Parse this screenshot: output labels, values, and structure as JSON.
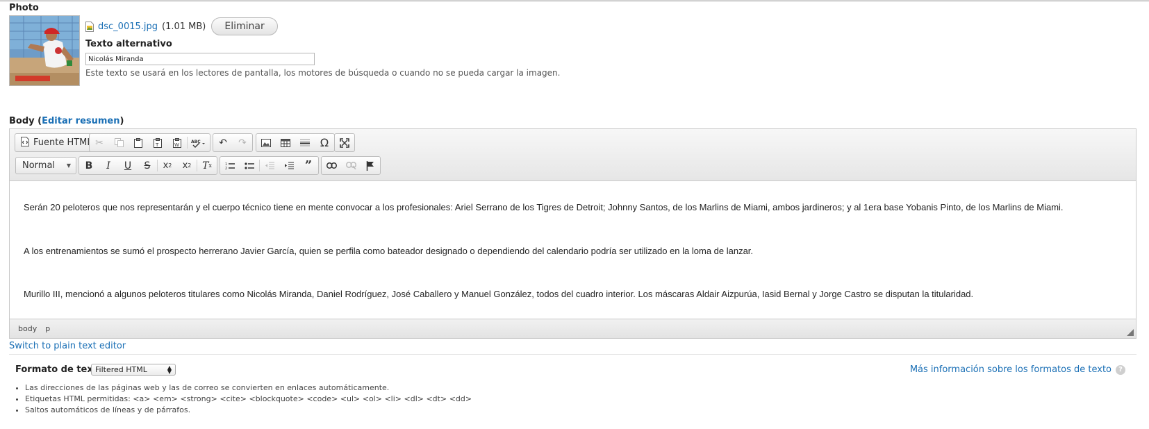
{
  "photo": {
    "label": "Photo",
    "file_name": "dsc_0015.jpg",
    "file_size": "(1.01 MB)",
    "remove_label": "Eliminar",
    "alt_label": "Texto alternativo",
    "alt_value": "Nicolás Miranda",
    "alt_help": "Este texto se usará en los lectores de pantalla, los motores de búsqueda o cuando no se pueda cargar la imagen."
  },
  "body": {
    "label": "Body (",
    "edit_summary": "Editar resumen",
    "label_close": ")"
  },
  "toolbar": {
    "source_label": "Fuente HTML",
    "format_value": "Normal",
    "icons_row1": [
      "cut-icon",
      "copy-icon",
      "paste-icon",
      "paste-text-icon",
      "paste-word-icon",
      "spellcheck-icon",
      "undo-icon",
      "redo-icon",
      "image-icon",
      "table-icon",
      "horizontal-rule-icon",
      "special-char-icon",
      "maximize-icon"
    ],
    "icons_row2": [
      "bold-icon",
      "italic-icon",
      "underline-icon",
      "strike-icon",
      "subscript-icon",
      "superscript-icon",
      "remove-format-icon",
      "numbered-list-icon",
      "bulleted-list-icon",
      "outdent-icon",
      "indent-icon",
      "blockquote-icon",
      "link-icon",
      "unlink-icon",
      "anchor-icon"
    ]
  },
  "content": {
    "paragraphs": [
      "Serán 20 peloteros que nos representarán y el cuerpo técnico tiene en mente convocar a los profesionales: Ariel Serrano de los Tigres de Detroit; Johnny Santos, de los Marlins de Miami, ambos jardineros; y al 1era base Yobanis Pinto, de los Marlins de Miami.",
      "A los entrenamientos se sumó el prospecto herrerano Javier García, quien se perfila como bateador designado o dependiendo del calendario podría ser utilizado en la loma de lanzar.",
      "Murillo III, mencionó a algunos peloteros titulares como Nicolás Miranda, Daniel Rodríguez, José Caballero y Manuel González, todos del cuadro interior. Los máscaras Aldair Aizpurúa, Iasid Bernal y Jorge Castro se disputan la titularidad."
    ]
  },
  "pathbar": {
    "items": [
      "body",
      "p"
    ]
  },
  "switch_editor": "Switch to plain text editor",
  "text_format": {
    "label": "Formato de texto",
    "selected": "Filtered HTML",
    "more_info": "Más información sobre los formatos de texto",
    "tips": [
      "Las direcciones de las páginas web y las de correo se convierten en enlaces automáticamente.",
      "Etiquetas HTML permitidas: <a> <em> <strong> <cite> <blockquote> <code> <ul> <ol> <li> <dl> <dt> <dd>",
      "Saltos automáticos de líneas y de párrafos."
    ]
  },
  "colors": {
    "link": "#1a6fb5",
    "toolbar_bg": "#eeeeee",
    "border": "#c9c9c9"
  }
}
